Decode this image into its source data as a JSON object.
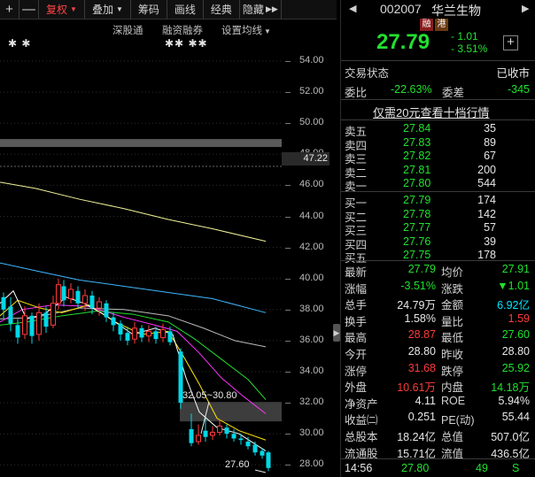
{
  "toolbar": {
    "items": [
      {
        "label": "+"
      },
      {
        "label": "—"
      },
      {
        "label": "复权",
        "active": true
      },
      {
        "label": "叠加"
      },
      {
        "label": "筹码"
      },
      {
        "label": "画线"
      },
      {
        "label": "经典"
      },
      {
        "label": "隐藏"
      }
    ]
  },
  "chart": {
    "links": [
      "深股通",
      "融资融券",
      "设置均线"
    ],
    "stars_left": "✱ ✱",
    "stars_right": "✱✱ ✱✱",
    "price_ticks": [
      "54.00",
      "52.00",
      "50.00",
      "48.00",
      "46.00",
      "44.00",
      "42.00",
      "40.00",
      "38.00",
      "36.00",
      "34.00",
      "32.00",
      "30.00",
      "28.00"
    ],
    "cursor_price": "47.22",
    "range_label": "32.05~30.80",
    "low_label": "27.60",
    "colors": {
      "up": "#ff3b3b",
      "down": "#00d8e8",
      "ma5": "#ffffff",
      "ma10": "#ffe600",
      "ma20": "#ff33ff",
      "ma30": "#22e02f",
      "ma60": "#bbbbbb",
      "ma120": "#3fb7ff",
      "ma250": "#f2f29a"
    }
  },
  "quote": {
    "code": "002007",
    "name": "华兰生物",
    "tag_rong": "融",
    "tag_gang": "港",
    "price": "27.79",
    "change": "- 1.01",
    "change_pct": "- 3.51%",
    "trade_status_label": "交易状态",
    "trade_status_value": "已收市",
    "weibi_label": "委比",
    "weibi_value": "-22.63%",
    "weicha_label": "委差",
    "weicha_value": "-345",
    "ten_levels_link": "仅需20元查看十档行情"
  },
  "orderbook": {
    "asks": [
      {
        "label": "卖五",
        "price": "27.84",
        "vol": "35"
      },
      {
        "label": "卖四",
        "price": "27.83",
        "vol": "89"
      },
      {
        "label": "卖三",
        "price": "27.82",
        "vol": "67"
      },
      {
        "label": "卖二",
        "price": "27.81",
        "vol": "200"
      },
      {
        "label": "卖一",
        "price": "27.80",
        "vol": "544"
      }
    ],
    "bids": [
      {
        "label": "买一",
        "price": "27.79",
        "vol": "174"
      },
      {
        "label": "买二",
        "price": "27.78",
        "vol": "142"
      },
      {
        "label": "买三",
        "price": "27.77",
        "vol": "57"
      },
      {
        "label": "买四",
        "price": "27.76",
        "vol": "39"
      },
      {
        "label": "买五",
        "price": "27.75",
        "vol": "178"
      }
    ]
  },
  "stats": [
    {
      "l1": "最新",
      "v1": "27.79",
      "c1": "green",
      "l2": "均价",
      "v2": "27.91",
      "c2": "green"
    },
    {
      "l1": "涨幅",
      "v1": "-3.51%",
      "c1": "green",
      "l2": "涨跌",
      "v2": "▼1.01",
      "c2": "green"
    },
    {
      "l1": "总手",
      "v1": "24.79万",
      "c1": "white",
      "l2": "金额",
      "v2": "6.92亿",
      "c2": "cyanish"
    },
    {
      "l1": "换手",
      "v1": "1.58%",
      "c1": "white",
      "l2": "量比",
      "v2": "1.59",
      "c2": "red"
    },
    {
      "l1": "最高",
      "v1": "28.87",
      "c1": "red",
      "l2": "最低",
      "v2": "27.60",
      "c2": "green"
    },
    {
      "l1": "今开",
      "v1": "28.80",
      "c1": "white",
      "l2": "昨收",
      "v2": "28.80",
      "c2": "white"
    },
    {
      "l1": "涨停",
      "v1": "31.68",
      "c1": "red",
      "l2": "跌停",
      "v2": "25.92",
      "c2": "green"
    },
    {
      "l1": "外盘",
      "v1": "10.61万",
      "c1": "red",
      "l2": "内盘",
      "v2": "14.18万",
      "c2": "green"
    },
    {
      "l1": "净资产",
      "v1": "4.11",
      "c1": "white",
      "l2": "ROE",
      "v2": "5.94%",
      "c2": "white"
    },
    {
      "l1": "收益㈡",
      "v1": "0.251",
      "c1": "white",
      "l2": "PE(动)",
      "v2": "55.44",
      "c2": "white"
    },
    {
      "l1": "总股本",
      "v1": "18.24亿",
      "c1": "white",
      "l2": "总值",
      "v2": "507.0亿",
      "c2": "white"
    },
    {
      "l1": "流通股",
      "v1": "15.71亿",
      "c1": "white",
      "l2": "流值",
      "v2": "436.5亿",
      "c2": "white"
    }
  ],
  "tick": {
    "time": "14:56",
    "price": "27.80",
    "vol": "49",
    "flag": "S"
  }
}
